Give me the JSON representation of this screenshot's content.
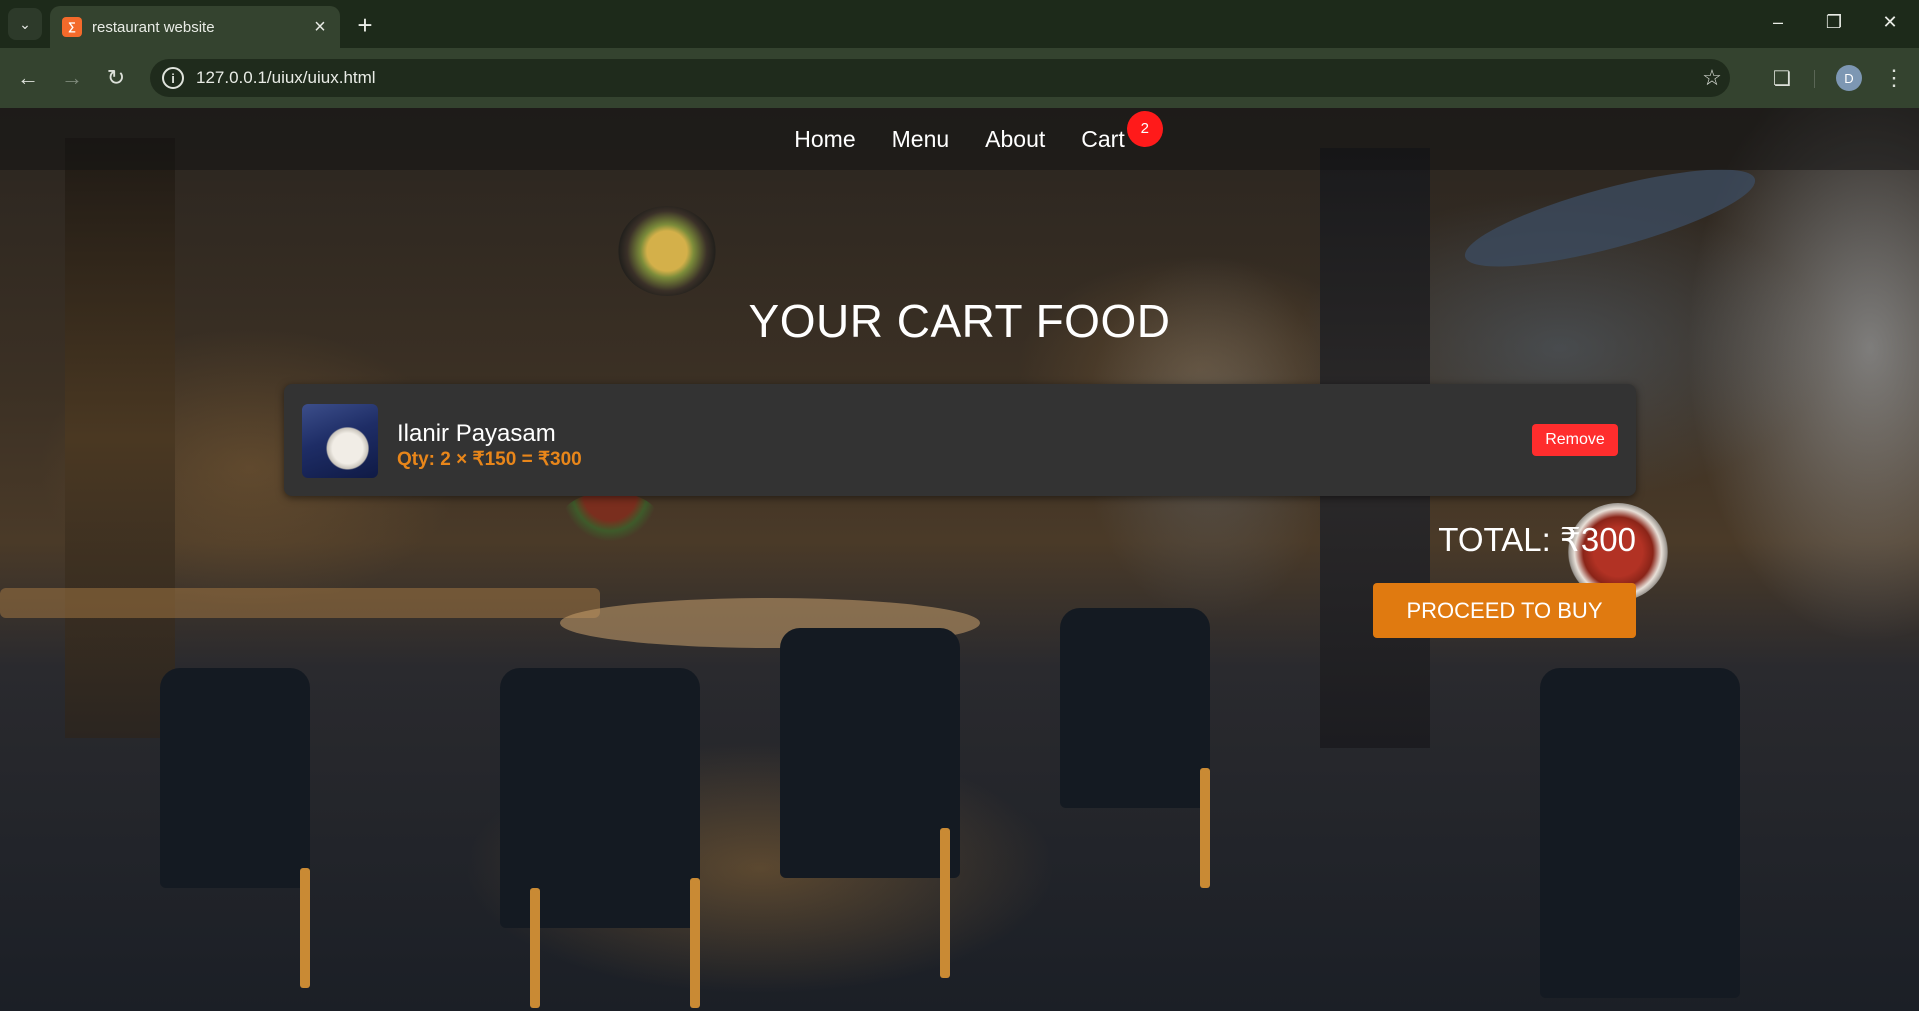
{
  "browser": {
    "tab_title": "restaurant website",
    "url": "127.0.0.1/uiux/uiux.html",
    "profile_initial": "D"
  },
  "nav": {
    "home": "Home",
    "menu": "Menu",
    "about": "About",
    "cart": "Cart",
    "cart_count": "2"
  },
  "cart": {
    "title": "YOUR CART FOOD",
    "items": [
      {
        "name": "Ilanir Payasam",
        "qty_line": "Qty: 2 × ₹150 = ₹300",
        "remove_label": "Remove"
      }
    ],
    "total": "TOTAL: ₹300",
    "proceed_label": "PROCEED TO BUY"
  },
  "colors": {
    "accent_orange": "#e07a10",
    "remove_red": "#ff2d2d",
    "badge_red": "#ff1a1a",
    "card_bg": "#333333"
  }
}
